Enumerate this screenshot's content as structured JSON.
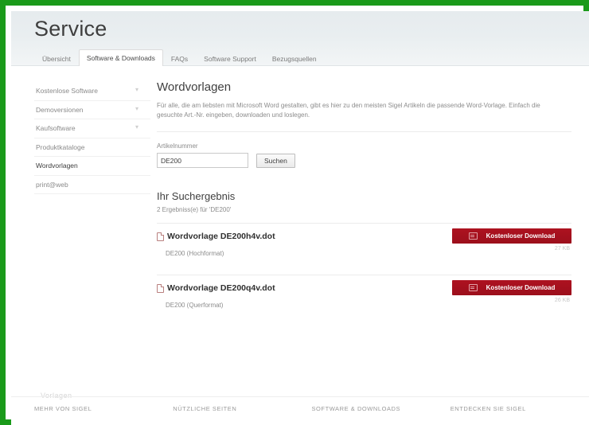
{
  "theme": {
    "frame_border_color": "#1a9a1a",
    "accent_red": "#ad1220",
    "header_bg": "#e8edef"
  },
  "header": {
    "title": "Service",
    "tabs": [
      {
        "label": "Übersicht",
        "active": false
      },
      {
        "label": "Software & Downloads",
        "active": true
      },
      {
        "label": "FAQs",
        "active": false
      },
      {
        "label": "Software Support",
        "active": false
      },
      {
        "label": "Bezugsquellen",
        "active": false
      }
    ]
  },
  "sidebar": {
    "items": [
      {
        "label": "Kostenlose Software",
        "has_chevron": true,
        "active": false
      },
      {
        "label": "Demoversionen",
        "has_chevron": true,
        "active": false
      },
      {
        "label": "Kaufsoftware",
        "has_chevron": true,
        "active": false
      },
      {
        "label": "Produktkataloge",
        "has_chevron": false,
        "active": false
      },
      {
        "label": "Wordvorlagen",
        "has_chevron": false,
        "active": true
      },
      {
        "label": "print@web",
        "has_chevron": false,
        "active": false
      }
    ]
  },
  "main": {
    "title": "Wordvorlagen",
    "description": "Für alle, die am liebsten mit Microsoft Word gestalten, gibt es hier zu den meisten Sigel Artikeln die passende Word-Vorlage. Einfach die gesuchte Art.-Nr. eingeben, downloaden und loslegen.",
    "search": {
      "label": "Artikelnummer",
      "value": "DE200",
      "placeholder": "Artikelnummer",
      "button_label": "Suchen"
    },
    "results": {
      "heading": "Ihr Suchergebnis",
      "count_text": "2 Ergebniss(e) für 'DE200'",
      "items": [
        {
          "title": "Wordvorlage DE200h4v.dot",
          "subtitle": "DE200 (Hochformat)",
          "download_label": "Kostenloser Download",
          "size": "27 KB"
        },
        {
          "title": "Wordvorlage DE200q4v.dot",
          "subtitle": "DE200 (Querformat)",
          "download_label": "Kostenloser Download",
          "size": "26 KB"
        }
      ]
    }
  },
  "footer": {
    "ghost_text": "Vorlagen",
    "columns": [
      {
        "label": "MEHR VON SIGEL"
      },
      {
        "label": "NÜTZLICHE SEITEN"
      },
      {
        "label": "SOFTWARE & DOWNLOADS"
      },
      {
        "label": "ENTDECKEN SIE SIGEL"
      }
    ]
  }
}
